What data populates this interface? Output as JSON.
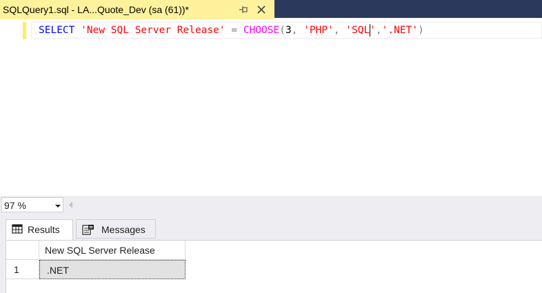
{
  "document_tab": {
    "title": "SQLQuery1.sql - LA...Quote_Dev (sa (61))*",
    "pin_icon": "pin-icon",
    "close_icon": "close-icon"
  },
  "editor": {
    "tokens": {
      "select": "SELECT",
      "alias": "'New SQL Server Release'",
      "equals": " = ",
      "choose": "CHOOSE",
      "open_paren": "(",
      "index": "3",
      "comma1": ", ",
      "arg1": "'PHP'",
      "comma2": ", ",
      "arg2": "'SQL'",
      "comma3": ",",
      "arg3": "'.NET'",
      "close_paren": ")"
    }
  },
  "zoom": {
    "value": "97 %"
  },
  "results": {
    "tabs": [
      {
        "label": "Results",
        "icon": "grid-icon"
      },
      {
        "label": "Messages",
        "icon": "messages-icon"
      }
    ],
    "grid": {
      "columns": [
        "New SQL Server Release"
      ],
      "rows": [
        {
          "row_number": "1",
          "values": [
            ".NET"
          ]
        }
      ]
    }
  },
  "colors": {
    "tab_active": "#fff29d",
    "tabstrip": "#2b3a5c",
    "keyword": "#0000ff",
    "string": "#ff0000",
    "function": "#ff00ff",
    "operator": "#808080"
  }
}
